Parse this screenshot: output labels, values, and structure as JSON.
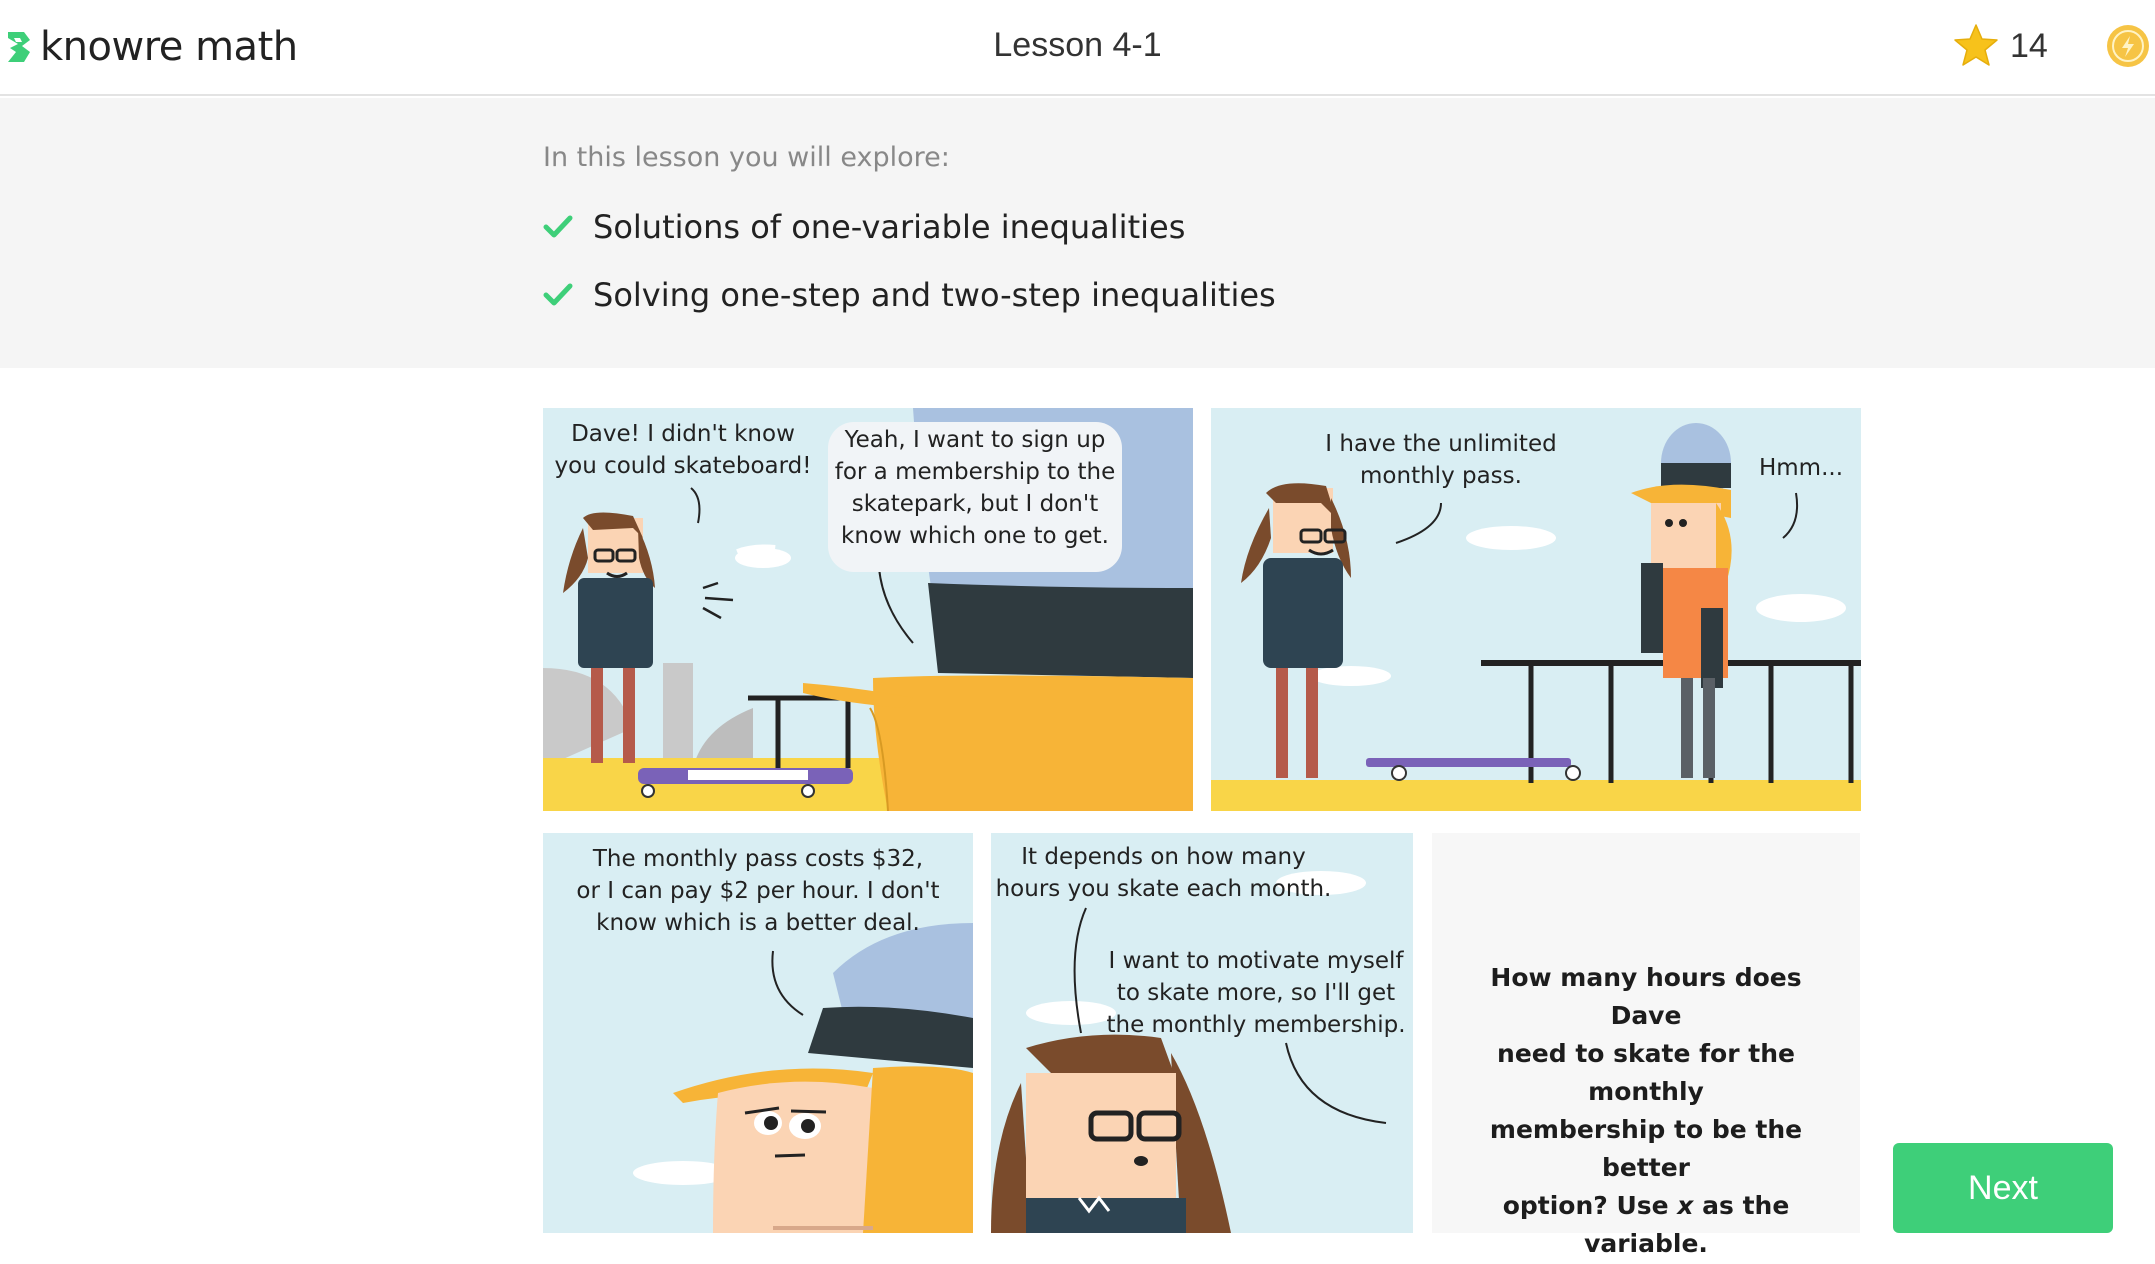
{
  "header": {
    "logo_text": "knowre math",
    "lesson_title": "Lesson 4-1",
    "star_count": "14"
  },
  "objectives": {
    "intro": "In this lesson you will explore:",
    "items": [
      "Solutions of one-variable inequalities",
      "Solving one-step and two-step inequalities"
    ]
  },
  "comic": {
    "panel1": {
      "bubble_a": [
        "Dave!  I didn't know",
        "you could skateboard!"
      ],
      "bubble_b": [
        "Yeah, I want to sign up",
        "for a membership to the",
        "skatepark, but I don't",
        "know which one to get."
      ]
    },
    "panel2": {
      "bubble_a": [
        "I have the unlimited",
        "monthly pass."
      ],
      "bubble_b": [
        "Hmm..."
      ]
    },
    "panel3": {
      "bubble_a": [
        "The monthly pass costs $32,",
        "or I can pay $2 per hour.  I don't",
        "know which is a better deal."
      ]
    },
    "panel4": {
      "bubble_a": [
        "It depends on how many",
        "hours you skate each month."
      ],
      "bubble_b": [
        "I want to motivate myself",
        "to skate more, so I'll get",
        "the monthly membership."
      ]
    },
    "question": {
      "lines": [
        "How many hours does Dave",
        "need to skate for the monthly",
        "membership to be the better",
        "option?  Use "
      ],
      "variable": "x",
      "tail": " as the variable."
    }
  },
  "actions": {
    "next_label": "Next"
  },
  "colors": {
    "accent_green": "#3ecf79",
    "star": "#f7c21b",
    "coin": "#f6c445",
    "sky": "#d9eef3",
    "ground": "#f9d548"
  }
}
